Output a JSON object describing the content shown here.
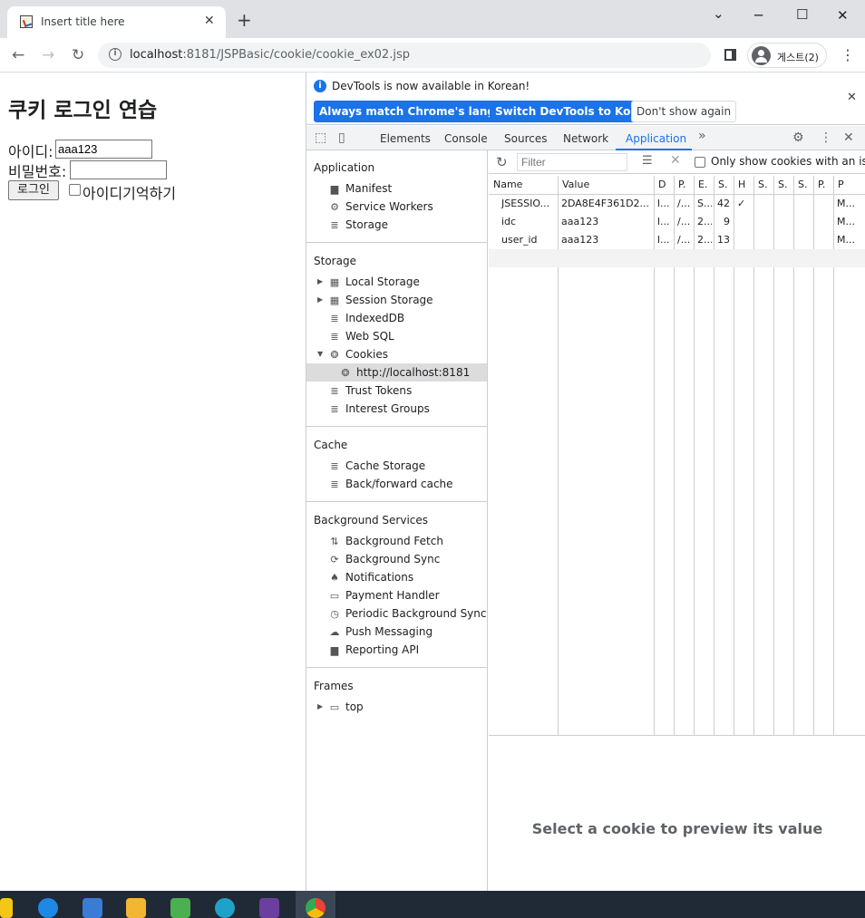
{
  "browser": {
    "tab_title": "Insert title here",
    "tab_close": "✕",
    "new_tab": "+",
    "url_host": "localhost",
    "url_rest": ":8181/JSPBasic/cookie/cookie_ex02.jsp",
    "profile_name": "게스트(2)"
  },
  "page": {
    "heading": "쿠키 로그인 연습",
    "id_label": "아이디:",
    "id_value": "aaa123",
    "pw_label": "비밀번호:",
    "pw_value": "",
    "login_button": "로그인",
    "remember_label": "아이디기억하기"
  },
  "devtools": {
    "info_message": "DevTools is now available in Korean!",
    "btn_match": "Always match Chrome's language",
    "btn_switch": "Switch DevTools to Korean",
    "btn_dont_show": "Don't show again",
    "tabs": [
      "Elements",
      "Console",
      "Sources",
      "Network",
      "Application"
    ],
    "active_tab": "Application",
    "more_tabs": "»",
    "sidebar": {
      "application_header": "Application",
      "application_items": [
        "Manifest",
        "Service Workers",
        "Storage"
      ],
      "storage_header": "Storage",
      "storage_items": [
        "Local Storage",
        "Session Storage",
        "IndexedDB",
        "Web SQL",
        "Cookies"
      ],
      "cookie_origin": "http://localhost:8181",
      "storage_items2": [
        "Trust Tokens",
        "Interest Groups"
      ],
      "cache_header": "Cache",
      "cache_items": [
        "Cache Storage",
        "Back/forward cache"
      ],
      "bg_header": "Background Services",
      "bg_items": [
        "Background Fetch",
        "Background Sync",
        "Notifications",
        "Payment Handler",
        "Periodic Background Sync",
        "Push Messaging",
        "Reporting API"
      ],
      "frames_header": "Frames",
      "frames_items": [
        "top"
      ]
    },
    "cookies": {
      "filter_placeholder": "Filter",
      "issue_label": "Only show cookies with an issue",
      "columns": [
        "Name",
        "Value",
        "D",
        "P.",
        "E.",
        "S.",
        "H",
        "S.",
        "S.",
        "S.",
        "P.",
        "P"
      ],
      "rows": [
        [
          "JSESSIO...",
          "2DA8E4F361D2...",
          "l...",
          "/...",
          "S...",
          "42",
          "✓",
          "",
          "",
          "",
          "",
          "M..."
        ],
        [
          "idc",
          "aaa123",
          "l...",
          "/...",
          "2...",
          "9",
          "",
          "",
          "",
          "",
          "",
          "M..."
        ],
        [
          "user_id",
          "aaa123",
          "l...",
          "/...",
          "2...",
          "13",
          "",
          "",
          "",
          "",
          "",
          "M..."
        ]
      ],
      "preview_text": "Select a cookie to preview its value"
    }
  },
  "colors": {
    "accent": "#1a73e8",
    "tabstrip": "#dfe1e5",
    "taskbar": "#202a36"
  }
}
